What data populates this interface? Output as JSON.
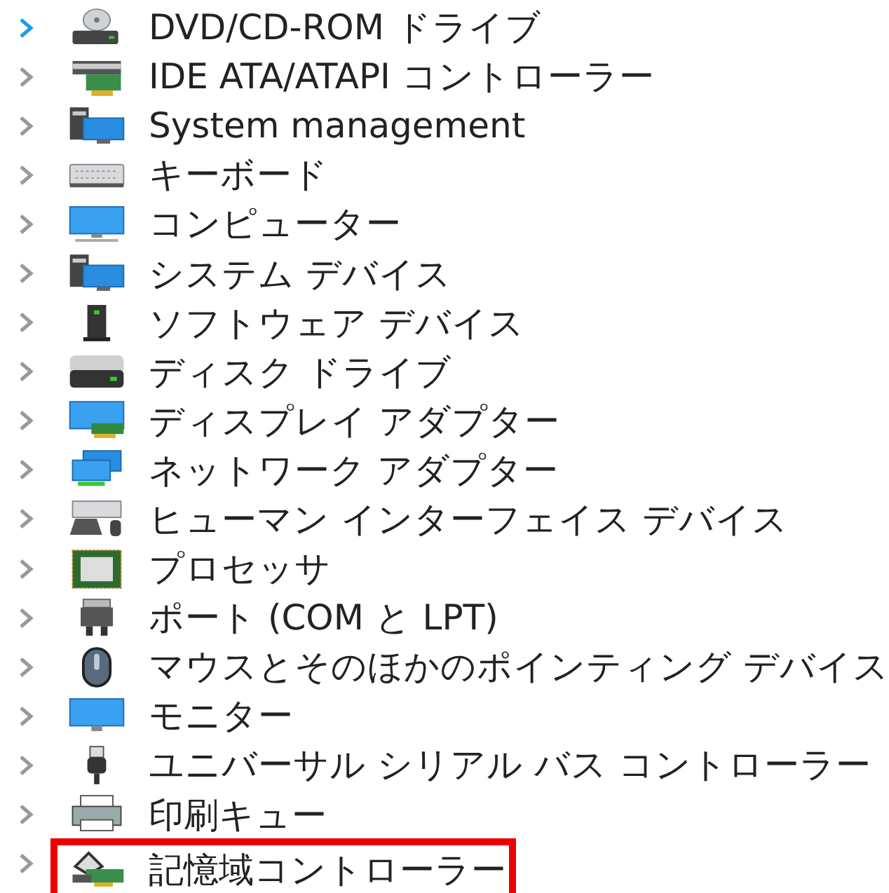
{
  "device_tree": {
    "items": [
      {
        "label": "DVD/CD-ROM ドライブ",
        "kind": "dvd",
        "focused": true,
        "marked": false
      },
      {
        "label": "IDE ATA/ATAPI コントローラー",
        "kind": "controller",
        "focused": false,
        "marked": false
      },
      {
        "label": "System management",
        "kind": "system",
        "focused": false,
        "marked": false
      },
      {
        "label": "キーボード",
        "kind": "keyboard",
        "focused": false,
        "marked": false
      },
      {
        "label": "コンピューター",
        "kind": "computer",
        "focused": false,
        "marked": false
      },
      {
        "label": "システム デバイス",
        "kind": "system",
        "focused": false,
        "marked": false
      },
      {
        "label": "ソフトウェア デバイス",
        "kind": "software",
        "focused": false,
        "marked": false
      },
      {
        "label": "ディスク ドライブ",
        "kind": "disk",
        "focused": false,
        "marked": false
      },
      {
        "label": "ディスプレイ アダプター",
        "kind": "display",
        "focused": false,
        "marked": false
      },
      {
        "label": "ネットワーク アダプター",
        "kind": "network",
        "focused": false,
        "marked": false
      },
      {
        "label": "ヒューマン インターフェイス デバイス",
        "kind": "hid",
        "focused": false,
        "marked": false
      },
      {
        "label": "プロセッサ",
        "kind": "processor",
        "focused": false,
        "marked": false
      },
      {
        "label": "ポート (COM と LPT)",
        "kind": "port",
        "focused": false,
        "marked": false
      },
      {
        "label": "マウスとそのほかのポインティング デバイス",
        "kind": "mouse",
        "focused": false,
        "marked": false
      },
      {
        "label": "モニター",
        "kind": "monitor",
        "focused": false,
        "marked": false
      },
      {
        "label": "ユニバーサル シリアル バス コントローラー",
        "kind": "usb",
        "focused": false,
        "marked": false
      },
      {
        "label": "印刷キュー",
        "kind": "printer",
        "focused": false,
        "marked": false
      },
      {
        "label": "記憶域コントローラー",
        "kind": "storage",
        "focused": false,
        "marked": true
      }
    ]
  }
}
